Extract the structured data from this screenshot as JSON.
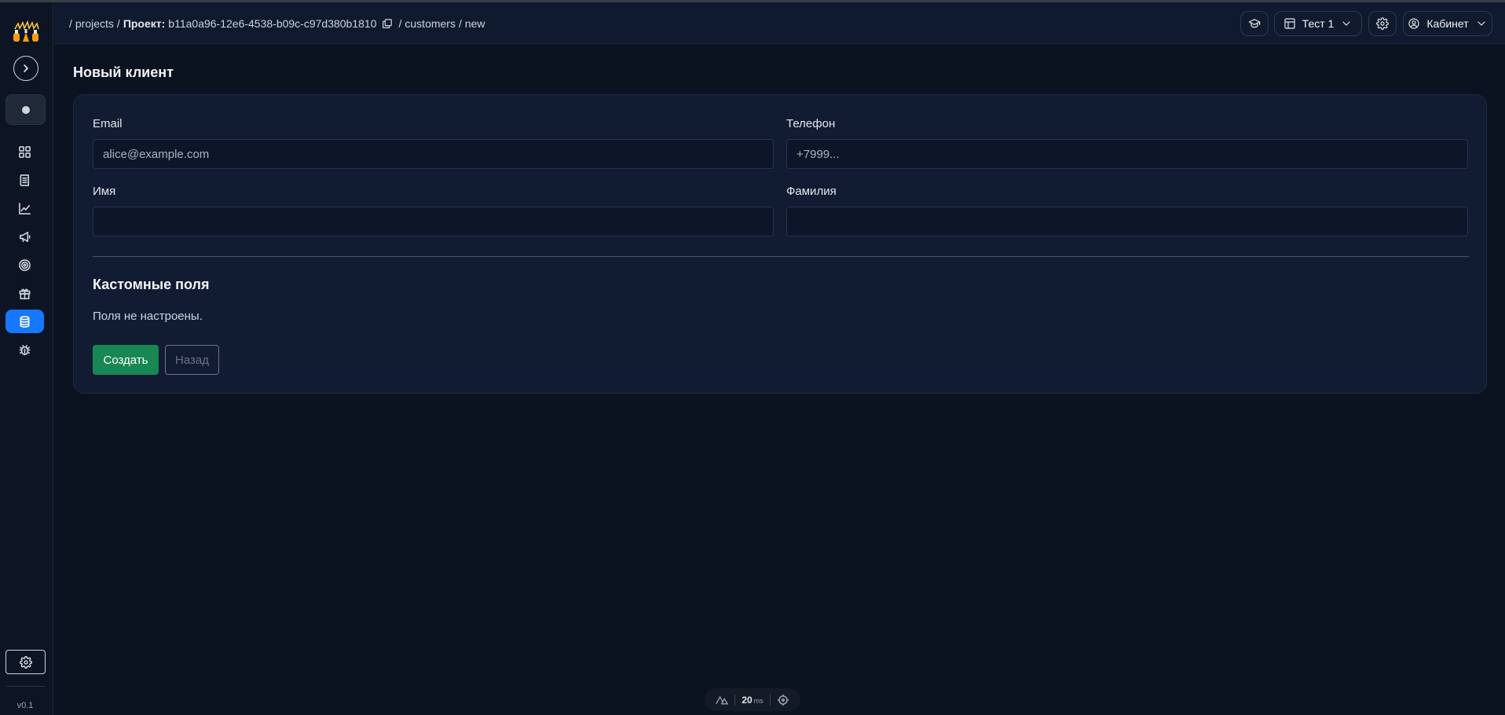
{
  "app": {
    "version": "v0.1"
  },
  "sidebar": {
    "items": [
      {
        "name": "dashboard",
        "icon": "grid-icon",
        "active": false
      },
      {
        "name": "journal",
        "icon": "document-icon",
        "active": false
      },
      {
        "name": "analytics",
        "icon": "chart-line-icon",
        "active": false
      },
      {
        "name": "campaigns",
        "icon": "megaphone-icon",
        "active": false
      },
      {
        "name": "targets",
        "icon": "target-icon",
        "active": false
      },
      {
        "name": "rewards",
        "icon": "gift-icon",
        "active": false
      },
      {
        "name": "database",
        "icon": "database-icon",
        "active": true
      },
      {
        "name": "debug",
        "icon": "bug-icon",
        "active": false
      }
    ],
    "accent": "#1677ff"
  },
  "header": {
    "breadcrumb": {
      "projects": "projects",
      "project_label": "Проект:",
      "project_id": "b11a0a96-12e6-4538-b09c-c97d380b1810",
      "customers": "customers",
      "new": "new"
    },
    "workspace_label": "Тест 1",
    "account_label": "Кабинет"
  },
  "page": {
    "title": "Новый клиент",
    "fields": {
      "email": {
        "label": "Email",
        "placeholder": "alice@example.com",
        "value": ""
      },
      "phone": {
        "label": "Телефон",
        "placeholder": "+7999...",
        "value": ""
      },
      "first_name": {
        "label": "Имя",
        "placeholder": "",
        "value": ""
      },
      "last_name": {
        "label": "Фамилия",
        "placeholder": "",
        "value": ""
      }
    },
    "custom_fields": {
      "title": "Кастомные поля",
      "empty_text": "Поля не настроены."
    },
    "buttons": {
      "create": "Создать",
      "back": "Назад"
    },
    "colors": {
      "create": "#198754"
    }
  },
  "dev_status": {
    "value": "20",
    "unit": "ms"
  }
}
